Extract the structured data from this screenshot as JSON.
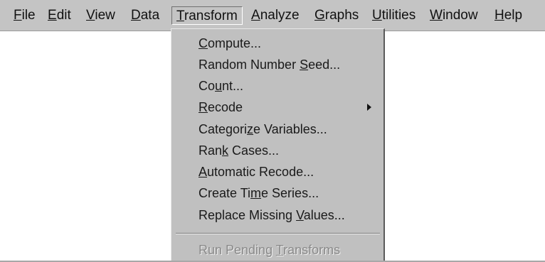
{
  "menubar": {
    "items": [
      {
        "pre": "",
        "key": "F",
        "post": "ile"
      },
      {
        "pre": "",
        "key": "E",
        "post": "dit"
      },
      {
        "pre": "",
        "key": "V",
        "post": "iew"
      },
      {
        "pre": "",
        "key": "D",
        "post": "ata"
      },
      {
        "pre": "",
        "key": "T",
        "post": "ransform"
      },
      {
        "pre": "",
        "key": "A",
        "post": "nalyze"
      },
      {
        "pre": "",
        "key": "G",
        "post": "raphs"
      },
      {
        "pre": "",
        "key": "U",
        "post": "tilities"
      },
      {
        "pre": "",
        "key": "W",
        "post": "indow"
      },
      {
        "pre": "",
        "key": "H",
        "post": "elp"
      }
    ]
  },
  "transform_menu": {
    "items": [
      {
        "pre": "",
        "key": "C",
        "post": "ompute..."
      },
      {
        "pre": "Random Number ",
        "key": "S",
        "post": "eed..."
      },
      {
        "pre": "Co",
        "key": "u",
        "post": "nt..."
      },
      {
        "pre": "",
        "key": "R",
        "post": "ecode"
      },
      {
        "pre": "Categori",
        "key": "z",
        "post": "e Variables..."
      },
      {
        "pre": "Ran",
        "key": "k",
        "post": " Cases..."
      },
      {
        "pre": "",
        "key": "A",
        "post": "utomatic Recode..."
      },
      {
        "pre": "Create Ti",
        "key": "m",
        "post": "e Series..."
      },
      {
        "pre": "Replace Missing ",
        "key": "V",
        "post": "alues..."
      }
    ],
    "disabled_item": {
      "pre": "Run Pending ",
      "key": "T",
      "post": "ransforms"
    }
  }
}
